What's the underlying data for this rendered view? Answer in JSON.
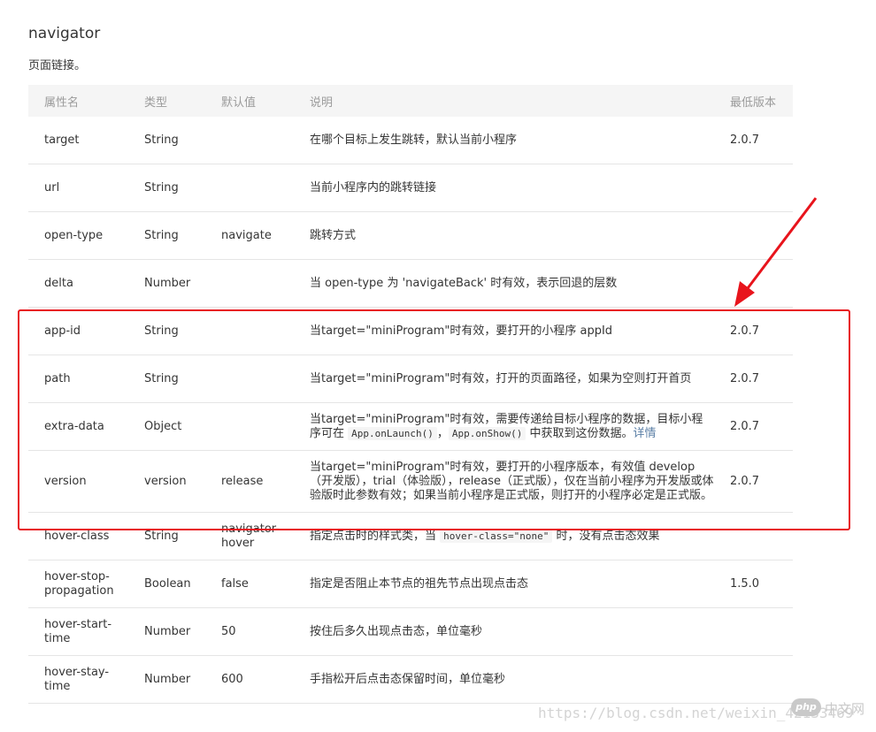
{
  "heading": {
    "title": "navigator",
    "subtitle": "页面链接。"
  },
  "table": {
    "headers": {
      "name": "属性名",
      "type": "类型",
      "default": "默认值",
      "desc": "说明",
      "version": "最低版本"
    },
    "rows": [
      {
        "name": "target",
        "type": "String",
        "default": "",
        "desc": "在哪个目标上发生跳转，默认当前小程序",
        "version": "2.0.7"
      },
      {
        "name": "url",
        "type": "String",
        "default": "",
        "desc": "当前小程序内的跳转链接",
        "version": ""
      },
      {
        "name": "open-type",
        "type": "String",
        "default": "navigate",
        "desc": "跳转方式",
        "version": ""
      },
      {
        "name": "delta",
        "type": "Number",
        "default": "",
        "desc": "当 open-type 为 'navigateBack' 时有效，表示回退的层数",
        "version": ""
      },
      {
        "name": "app-id",
        "type": "String",
        "default": "",
        "desc": "当target=\"miniProgram\"时有效，要打开的小程序 appId",
        "version": "2.0.7"
      },
      {
        "name": "path",
        "type": "String",
        "default": "",
        "desc": "当target=\"miniProgram\"时有效，打开的页面路径，如果为空则打开首页",
        "version": "2.0.7"
      },
      {
        "name": "extra-data",
        "type": "Object",
        "default": "",
        "desc_pre": "当target=\"miniProgram\"时有效，需要传递给目标小程序的数据，目标小程序可在 ",
        "code1": "App.onLaunch()",
        "desc_mid": "，",
        "code2": "App.onShow()",
        "desc_post": " 中获取到这份数据。",
        "link": "详情",
        "version": "2.0.7"
      },
      {
        "name": "version",
        "type": "version",
        "default": "release",
        "desc": "当target=\"miniProgram\"时有效，要打开的小程序版本，有效值 develop（开发版），trial（体验版），release（正式版），仅在当前小程序为开发版或体验版时此参数有效；如果当前小程序是正式版，则打开的小程序必定是正式版。",
        "version": "2.0.7"
      },
      {
        "name": "hover-class",
        "type": "String",
        "default": "navigator-hover",
        "desc_pre": "指定点击时的样式类，当 ",
        "code1": "hover-class=\"none\"",
        "desc_post": " 时，没有点击态效果",
        "version": ""
      },
      {
        "name": "hover-stop-propagation",
        "type": "Boolean",
        "default": "false",
        "desc": "指定是否阻止本节点的祖先节点出现点击态",
        "version": "1.5.0"
      },
      {
        "name": "hover-start-time",
        "type": "Number",
        "default": "50",
        "desc": "按住后多久出现点击态，单位毫秒",
        "version": ""
      },
      {
        "name": "hover-stay-time",
        "type": "Number",
        "default": "600",
        "desc": "手指松开后点击态保留时间，单位毫秒",
        "version": ""
      }
    ]
  },
  "overlay": {
    "highlight_color": "#e8141c",
    "arrow_color": "#e8141c",
    "watermark": "https://blog.csdn.net/weixin_42133469",
    "site_logo_badge": "php",
    "site_logo_label": "中文网"
  },
  "colors": {
    "version_link": "#5b7fa6",
    "header_bg": "#f5f5f5",
    "border": "#e5e5e5"
  }
}
